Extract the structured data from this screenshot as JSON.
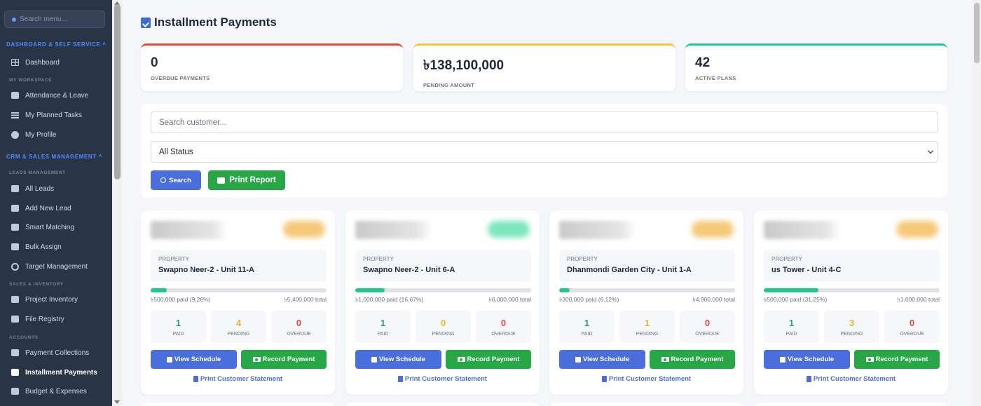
{
  "sidebar": {
    "search_placeholder": "Search menu...",
    "sections": {
      "dashboard": "DASHBOARD & SELF SERVICE",
      "crm": "CRM & SALES MANAGEMENT"
    },
    "subsections": {
      "workspace": "MY WORKSPACE",
      "leads": "LEADS MANAGEMENT",
      "sales": "SALES & INVENTORY",
      "accounts": "ACCOUNTS"
    },
    "items": [
      {
        "label": "Dashboard",
        "icon": "dashboard-icon"
      },
      {
        "label": "Attendance & Leave",
        "icon": "user-clock-icon"
      },
      {
        "label": "My Planned Tasks",
        "icon": "tasks-icon"
      },
      {
        "label": "My Profile",
        "icon": "user-circle-icon"
      },
      {
        "label": "All Leads",
        "icon": "address-book-icon"
      },
      {
        "label": "Add New Lead",
        "icon": "user-plus-icon"
      },
      {
        "label": "Smart Matching",
        "icon": "magic-icon"
      },
      {
        "label": "Bulk Assign",
        "icon": "layers-icon"
      },
      {
        "label": "Target Management",
        "icon": "crosshairs-icon"
      },
      {
        "label": "Project Inventory",
        "icon": "building-icon"
      },
      {
        "label": "File Registry",
        "icon": "file-icon"
      },
      {
        "label": "Payment Collections",
        "icon": "money-icon"
      },
      {
        "label": "Installment Payments",
        "icon": "calendar-check-icon",
        "active": true
      },
      {
        "label": "Budget & Expenses",
        "icon": "wallet-icon"
      }
    ]
  },
  "page": {
    "title": "Installment Payments"
  },
  "stats": [
    {
      "value": "0",
      "label": "OVERDUE PAYMENTS",
      "color": "#e04b3a"
    },
    {
      "value": "৳138,100,000",
      "label": "PENDING AMOUNT",
      "color": "#f5c542"
    },
    {
      "value": "42",
      "label": "ACTIVE PLANS",
      "color": "#1fc98c"
    }
  ],
  "filters": {
    "search_placeholder": "Search customer...",
    "status_value": "All Status",
    "search_button": "Search",
    "print_button": "Print Report"
  },
  "cards": [
    {
      "property_label": "PROPERTY",
      "property": "Swapno Neer-2 - Unit 11-A",
      "progress": 9.26,
      "paid_text": "৳500,000 paid (9.26%)",
      "total_text": "৳5,400,000 total",
      "paid": "1",
      "pending": "4",
      "overdue": "0",
      "paid_label": "PAID",
      "pending_label": "PENDING",
      "overdue_label": "OVERDUE",
      "view_label": "View Schedule",
      "record_label": "Record Payment",
      "statement_label": "Print Customer Statement",
      "badge_color": "#f5c97a"
    },
    {
      "property_label": "PROPERTY",
      "property": "Swapno Neer-2 - Unit 6-A",
      "progress": 16.67,
      "paid_text": "৳1,000,000 paid (16.67%)",
      "total_text": "৳6,000,000 total",
      "paid": "1",
      "pending": "0",
      "overdue": "0",
      "paid_label": "PAID",
      "pending_label": "PENDING",
      "overdue_label": "OVERDUE",
      "view_label": "View Schedule",
      "record_label": "Record Payment",
      "statement_label": "Print Customer Statement",
      "badge_color": "#7ee6bd"
    },
    {
      "property_label": "PROPERTY",
      "property": "Dhanmondi Garden City - Unit 1-A",
      "progress": 6.12,
      "paid_text": "৳300,000 paid (6.12%)",
      "total_text": "৳4,900,000 total",
      "paid": "1",
      "pending": "1",
      "overdue": "0",
      "paid_label": "PAID",
      "pending_label": "PENDING",
      "overdue_label": "OVERDUE",
      "view_label": "View Schedule",
      "record_label": "Record Payment",
      "statement_label": "Print Customer Statement",
      "badge_color": "#f5c97a"
    },
    {
      "property_label": "PROPERTY",
      "property": "us Tower - Unit 4-C",
      "progress": 31.25,
      "paid_text": "৳500,000 paid (31.25%)",
      "total_text": "৳1,600,000 total",
      "paid": "1",
      "pending": "3",
      "overdue": "0",
      "paid_label": "PAID",
      "pending_label": "PENDING",
      "overdue_label": "OVERDUE",
      "view_label": "View Schedule",
      "record_label": "Record Payment",
      "statement_label": "Print Customer Statement",
      "badge_color": "#f5c97a"
    }
  ],
  "colors": {
    "paid": "#1fa971",
    "pending": "#f0b429",
    "overdue": "#e04b3a"
  }
}
